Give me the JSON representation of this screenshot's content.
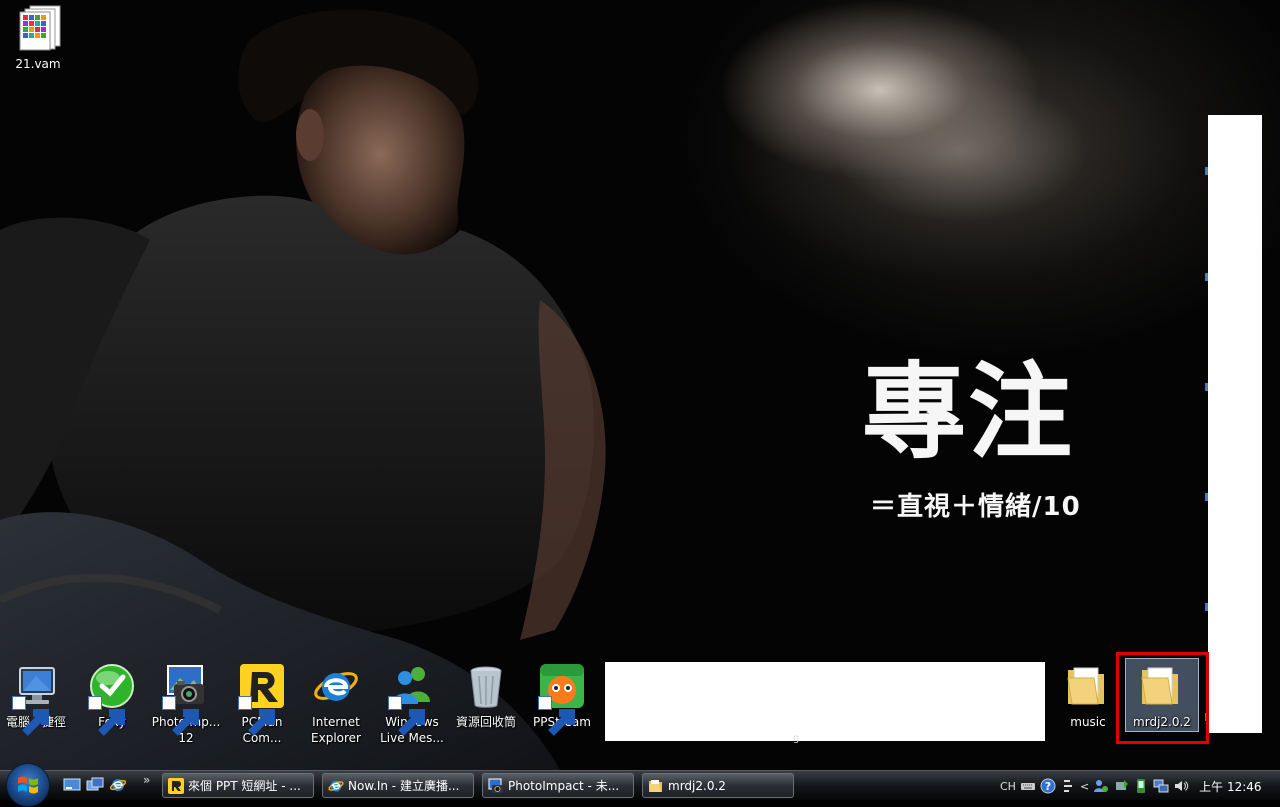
{
  "wallpaper": {
    "slogan_big": "專注",
    "slogan_small": "＝直視＋情緒/10",
    "under_text": "g"
  },
  "desktop": {
    "icons": [
      {
        "label": "21.vam",
        "icon": "vam-file-icon",
        "shortcut": false
      },
      {
        "label": "電腦 - 捷徑",
        "icon": "computer-icon",
        "shortcut": true
      },
      {
        "label": "Foxy",
        "icon": "foxy-icon",
        "shortcut": true
      },
      {
        "label": "PhotoImp... 12",
        "icon": "photoimpact-icon",
        "shortcut": true
      },
      {
        "label": "PCMan Com...",
        "icon": "pcman-icon",
        "shortcut": true
      },
      {
        "label": "Internet Explorer",
        "icon": "internet-explorer-icon",
        "shortcut": false
      },
      {
        "label": "Windows Live Mes...",
        "icon": "messenger-icon",
        "shortcut": true
      },
      {
        "label": "資源回收筒",
        "icon": "recycle-bin-icon",
        "shortcut": false
      },
      {
        "label": "PPStream",
        "icon": "ppstream-icon",
        "shortcut": true
      },
      {
        "label": "music",
        "icon": "folder-icon",
        "shortcut": false
      },
      {
        "label": "mrdj2.0.2",
        "icon": "folder-icon",
        "shortcut": false,
        "selected": true
      }
    ]
  },
  "taskbar": {
    "quicklaunch_more": "»",
    "tasks": [
      {
        "label": "來個 PPT 短網址 - ...",
        "icon": "ppt-url-icon"
      },
      {
        "label": "Now.In - 建立廣播...",
        "icon": "internet-explorer-icon"
      },
      {
        "label": "PhotoImpact - 未...",
        "icon": "photoimpact-icon"
      },
      {
        "label": "mrdj2.0.2",
        "icon": "folder-icon"
      }
    ],
    "tray": {
      "language": "CH",
      "chevron": "<",
      "clock": "上午 12:46"
    }
  },
  "colors": {
    "highlight": "#e00000",
    "folder": "#f2d27a",
    "taskbar": "#15171a"
  }
}
